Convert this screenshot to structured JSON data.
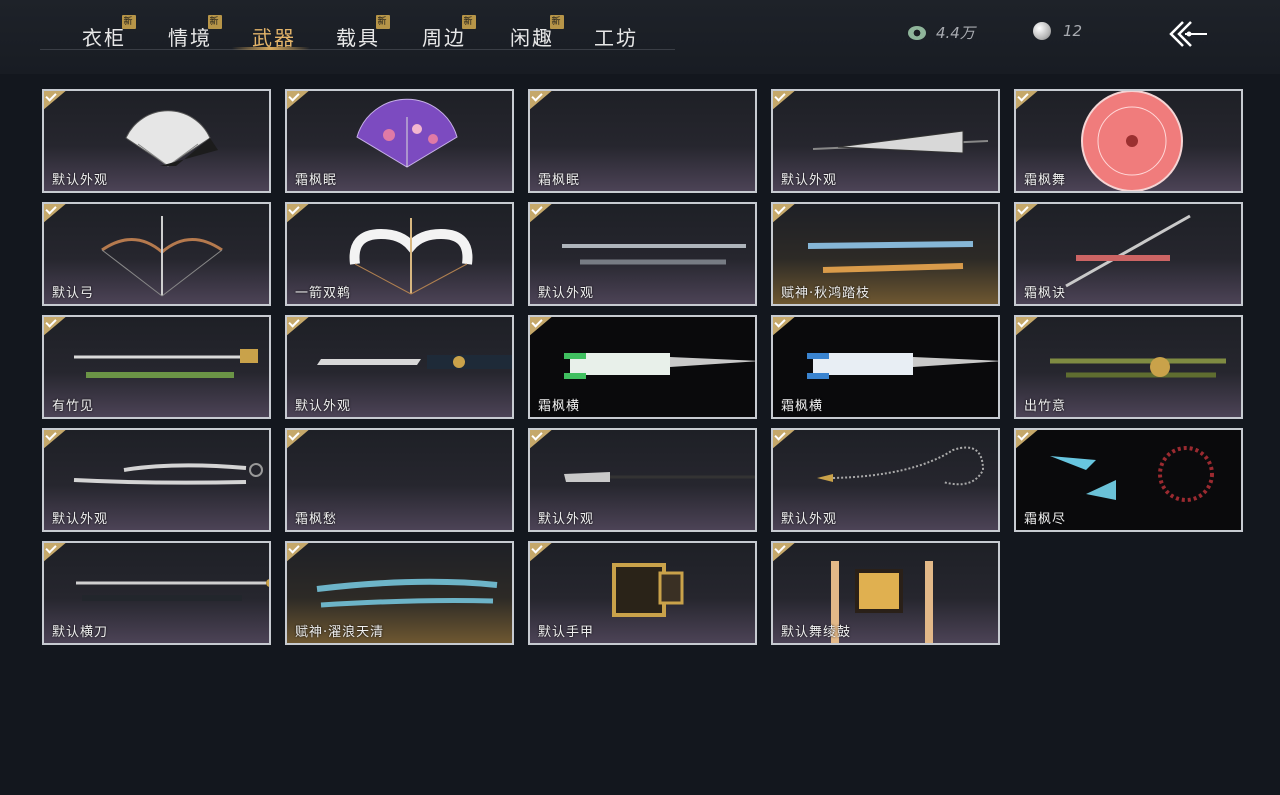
{
  "tabs": [
    {
      "label": "衣柜",
      "new": true
    },
    {
      "label": "情境",
      "new": true
    },
    {
      "label": "武器",
      "new": false,
      "active": true
    },
    {
      "label": "载具",
      "new": true
    },
    {
      "label": "周边",
      "new": true
    },
    {
      "label": "闲趣",
      "new": true
    },
    {
      "label": "工坊",
      "new": false
    }
  ],
  "new_badge": "新",
  "currency": {
    "jade": "4.4万",
    "pearl": "12"
  },
  "items": [
    {
      "label": "默认外观",
      "icon": "folding-fan-white"
    },
    {
      "label": "霜枫眠",
      "icon": "folding-fan-purple"
    },
    {
      "label": "霜枫眠",
      "icon": "empty"
    },
    {
      "label": "默认外观",
      "icon": "closed-umbrella"
    },
    {
      "label": "霜枫舞",
      "icon": "red-parasol"
    },
    {
      "label": "默认弓",
      "icon": "bow"
    },
    {
      "label": "一箭双鹈",
      "icon": "white-bow"
    },
    {
      "label": "默认外观",
      "icon": "twin-staff"
    },
    {
      "label": "赋神·秋鸿踏枝",
      "icon": "ornate-staff",
      "style": "gold"
    },
    {
      "label": "霜枫诀",
      "icon": "red-spear"
    },
    {
      "label": "有竹见",
      "icon": "bamboo-sword"
    },
    {
      "label": "默认外观",
      "icon": "sword"
    },
    {
      "label": "霜枫横",
      "icon": "green-blade",
      "style": "dark"
    },
    {
      "label": "霜枫横",
      "icon": "blue-blade",
      "style": "dark"
    },
    {
      "label": "出竹意",
      "icon": "bamboo-staff"
    },
    {
      "label": "默认外观",
      "icon": "twin-sabres"
    },
    {
      "label": "霜枫愁",
      "icon": "empty"
    },
    {
      "label": "默认外观",
      "icon": "glaive"
    },
    {
      "label": "默认外观",
      "icon": "rope-dart"
    },
    {
      "label": "霜枫尽",
      "icon": "crystal-rope-dart",
      "style": "dark"
    },
    {
      "label": "默认横刀",
      "icon": "horizontal-sabre"
    },
    {
      "label": "赋神·濯浪天清",
      "icon": "spirit-blade",
      "style": "gold"
    },
    {
      "label": "默认手甲",
      "icon": "gauntlet"
    },
    {
      "label": "默认舞绫鼓",
      "icon": "dance-drum"
    }
  ],
  "colors": {
    "accent": "#e3b46a",
    "badge": "#b79548",
    "check": "#c5a86a",
    "border": "#c7cbd1"
  }
}
